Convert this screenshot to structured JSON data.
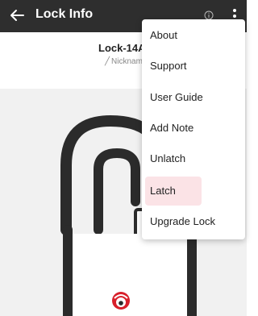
{
  "appbar": {
    "title": "Lock Info"
  },
  "lock": {
    "name": "Lock-14A",
    "nickname_placeholder": "Nicknam"
  },
  "menu": {
    "items": [
      {
        "label": "About"
      },
      {
        "label": "Support"
      },
      {
        "label": "User Guide"
      },
      {
        "label": "Add Note"
      },
      {
        "label": "Unlatch"
      },
      {
        "label": "Latch",
        "highlighted": true
      },
      {
        "label": "Upgrade Lock"
      }
    ]
  },
  "colors": {
    "appbar_bg": "#2e2e2e",
    "highlight": "#fbe3e6",
    "brand_red": "#d81f2a",
    "lock_area_bg": "#f1f1f1"
  }
}
